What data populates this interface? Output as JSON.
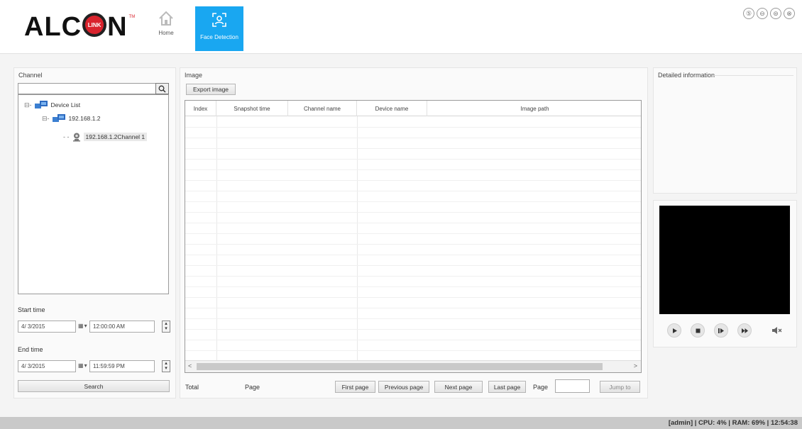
{
  "app": {
    "logo_text_left": "ALC",
    "logo_text_right": "N",
    "logo_inner": "LINK",
    "logo_tm": "TM",
    "brand_red": "#d9232d",
    "accent_blue": "#19a7f1"
  },
  "nav": {
    "home_label": "Home",
    "face_label": "Face Detection"
  },
  "window_controls": [
    {
      "name": "badge-icon",
      "glyph": "⑤"
    },
    {
      "name": "minimize-icon",
      "glyph": "⊖"
    },
    {
      "name": "settings-icon",
      "glyph": "⊜"
    },
    {
      "name": "close-icon",
      "glyph": "⊗"
    }
  ],
  "channel": {
    "title": "Channel",
    "search_value": "",
    "tree": {
      "root": "Device List",
      "device": "192.168.1.2",
      "channel": "192.168.1.2Channel 1"
    },
    "start_time_label": "Start time",
    "start_date": "4/ 3/2015",
    "start_time": "12:00:00 AM",
    "end_time_label": "End time",
    "end_date": "4/ 3/2015",
    "end_time": "11:59:59 PM",
    "search_button": "Search"
  },
  "image": {
    "title": "Image",
    "export_button": "Export image",
    "columns": [
      "Index",
      "Snapshot time",
      "Channel name",
      "Device name",
      "Image path"
    ],
    "rows": [],
    "total_label": "Total",
    "page_label": "Page",
    "first_page": "First page",
    "previous_page": "Previous page",
    "next_page": "Next page",
    "last_page": "Last page",
    "page_input_label": "Page",
    "page_input_value": "",
    "jump_button": "Jump to"
  },
  "detail": {
    "title": "Detailed information"
  },
  "player": {
    "buttons": [
      "play-icon",
      "stop-icon",
      "step-icon",
      "fast-forward-icon"
    ],
    "mute_icon": "mute-icon"
  },
  "status": {
    "text": "[admin] | CPU: 4% | RAM: 69% | 12:54:38"
  }
}
